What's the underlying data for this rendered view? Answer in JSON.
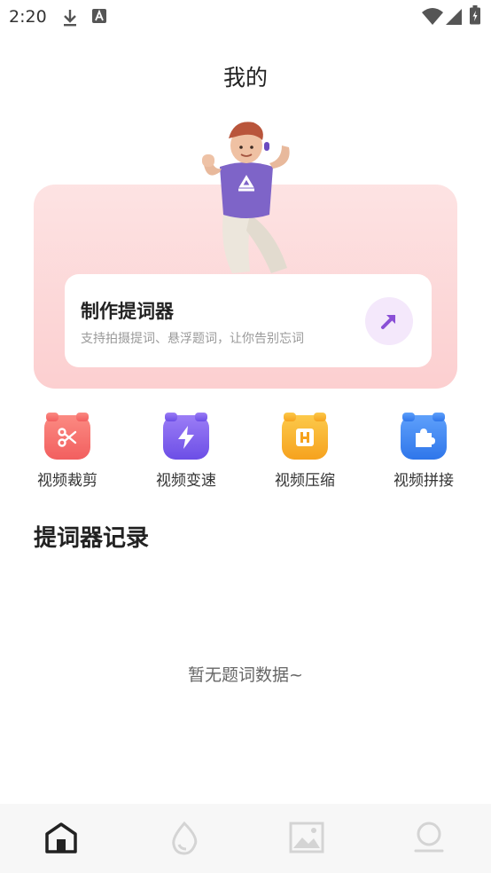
{
  "status_bar": {
    "time": "2:20",
    "icons": [
      "download-icon",
      "a-notification-icon",
      "wifi-icon",
      "signal-icon",
      "battery-icon"
    ]
  },
  "page": {
    "title": "我的"
  },
  "hero": {
    "illustration": "waving-character-illustration",
    "card_title": "制作提词器",
    "card_subtitle": "支持拍摄提词、悬浮题词，让你告别忘词",
    "go_icon": "arrow-up-right-icon",
    "bg_color": "#fcd6d7",
    "accent_color": "#8a4fd6"
  },
  "tools": [
    {
      "label": "视频裁剪",
      "icon": "scissors-icon",
      "color": "#f76b6b"
    },
    {
      "label": "视频变速",
      "icon": "lightning-icon",
      "color": "#7b5cf0"
    },
    {
      "label": "视频压缩",
      "icon": "compress-icon",
      "color": "#f9b12c"
    },
    {
      "label": "视频拼接",
      "icon": "puzzle-icon",
      "color": "#3b82f0"
    }
  ],
  "records": {
    "title": "提词器记录",
    "empty_text": "暂无题词数据~"
  },
  "bottom_nav": [
    {
      "icon": "home-icon",
      "active": true
    },
    {
      "icon": "drop-icon",
      "active": false
    },
    {
      "icon": "image-icon",
      "active": false
    },
    {
      "icon": "profile-icon",
      "active": false
    }
  ]
}
